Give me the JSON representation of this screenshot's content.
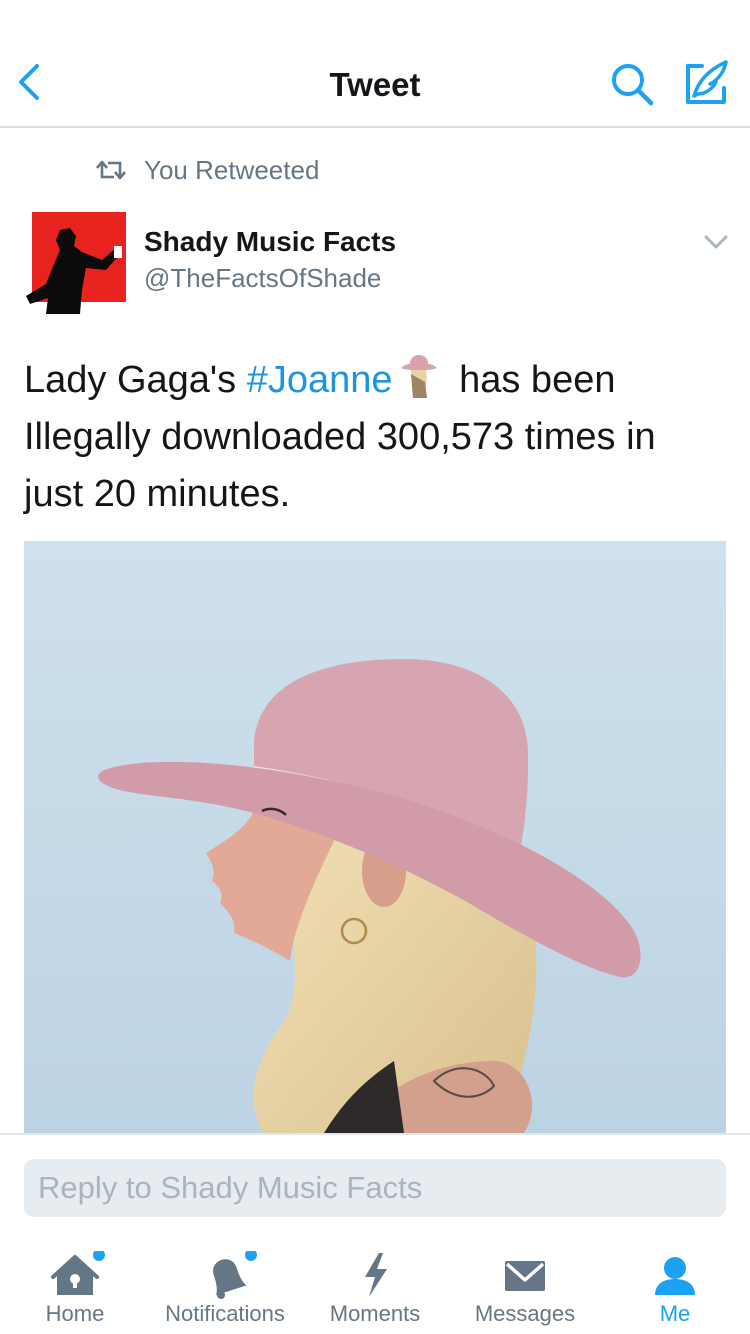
{
  "header": {
    "title": "Tweet",
    "back_icon": "chevron-left-icon",
    "search_icon": "search-icon",
    "compose_icon": "compose-icon",
    "accent_color": "#1da1f2"
  },
  "retweet_context": {
    "text": "You Retweeted",
    "icon": "retweet-icon"
  },
  "tweet": {
    "author_name": "Shady Music Facts",
    "author_handle": "@TheFactsOfShade",
    "text_before": "Lady Gaga's ",
    "hashtag": "#Joanne",
    "text_after": " has been Illegally downloaded 300,573 times in just 20 minutes.",
    "hashtag_color": "#1b95e0",
    "media_description_icon": "photo"
  },
  "reply": {
    "placeholder": "Reply to Shady Music Facts"
  },
  "tabbar": {
    "tabs": [
      {
        "label": "Home",
        "icon": "home-icon",
        "unread_dot": true,
        "active": false
      },
      {
        "label": "Notifications",
        "icon": "bell-icon",
        "unread_dot": true,
        "active": false
      },
      {
        "label": "Moments",
        "icon": "lightning-icon",
        "unread_dot": false,
        "active": false
      },
      {
        "label": "Messages",
        "icon": "envelope-icon",
        "unread_dot": false,
        "active": false
      },
      {
        "label": "Me",
        "icon": "person-icon",
        "unread_dot": false,
        "active": true
      }
    ]
  }
}
